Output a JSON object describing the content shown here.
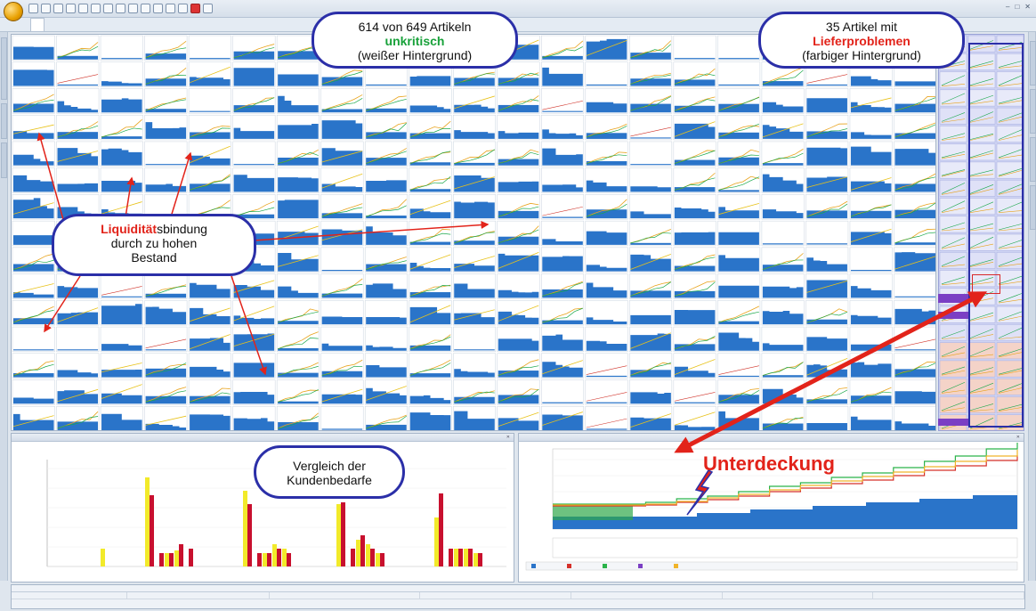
{
  "colors": {
    "bar_blue": "#2a74c9",
    "callout_border": "#2b2fa8",
    "highlight_red": "#e2231a",
    "highlight_green": "#18a13a",
    "chart_yellow": "#f2ea2a",
    "chart_red": "#c8102e",
    "critical_panel_bg": "#cfd4f3"
  },
  "app": {
    "icon": "app-orb-icon"
  },
  "callouts": {
    "unkritisch": {
      "line1": "614 von 649 Artikeln",
      "word": "unkritisch",
      "line3": "(weißer Hintergrund)"
    },
    "lieferprobleme": {
      "line1": "35 Artikel mit",
      "word": "Lieferproblemen",
      "line3": "(farbiger Hintergrund)"
    },
    "liquiditaet": {
      "word": "Liquidität",
      "rest": "sbindung",
      "line2": "durch zu hohen",
      "line3": "Bestand"
    },
    "vergleich": {
      "line1": "Vergleich der",
      "line2": "Kundenbedarfe"
    },
    "unterdeckung": "Unterdeckung"
  }
}
